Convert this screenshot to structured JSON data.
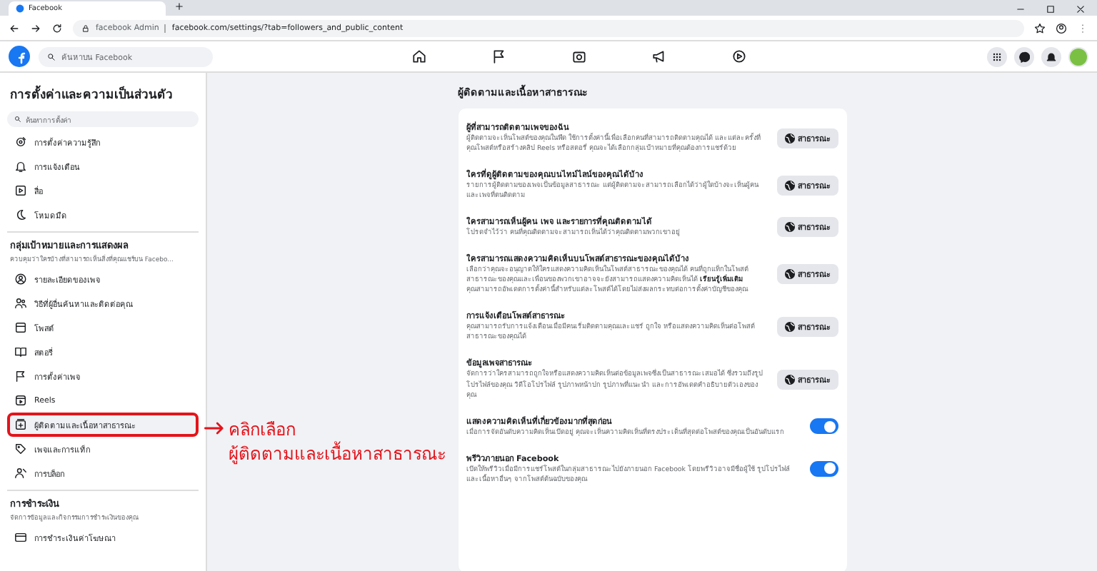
{
  "browser": {
    "tab_title": "Facebook",
    "address_label": "facebook Admin",
    "url": "facebook.com/settings/?tab=followers_and_public_content"
  },
  "header": {
    "search_placeholder": "ค้นหาบน Facebook"
  },
  "sidebar": {
    "title": "การตั้งค่าและความเป็นส่วนตัว",
    "search_placeholder": "ค้นหาการตั้งค่า",
    "sections": [
      {
        "items": [
          {
            "label": "การตั้งค่าความรู้สึก",
            "selected": false
          },
          {
            "label": "การแจ้งเตือน",
            "selected": false
          },
          {
            "label": "สื่อ",
            "selected": false
          },
          {
            "label": "โหมดมืด",
            "selected": false
          }
        ]
      },
      {
        "title": "กลุ่มเป้าหมายและการแสดงผล",
        "subtitle": "ควบคุมว่าใครบ้างที่สามารถเห็นสิ่งที่คุณแชร์บน Facebo...",
        "items": [
          {
            "label": "รายละเอียดของเพจ",
            "selected": false
          },
          {
            "label": "วิธีที่ผู้อื่นค้นหาและติดต่อคุณ",
            "selected": false
          },
          {
            "label": "โพสต์",
            "selected": false
          },
          {
            "label": "สตอรี่",
            "selected": false
          },
          {
            "label": "การตั้งค่าเพจ",
            "selected": false
          },
          {
            "label": "Reels",
            "selected": false
          },
          {
            "label": "ผู้ติดตามและเนื้อหาสาธารณะ",
            "selected": true
          },
          {
            "label": "เพจและการแท็ก",
            "selected": false
          },
          {
            "label": "การบล็อก",
            "selected": false
          }
        ]
      },
      {
        "title": "การชำระเงิน",
        "subtitle": "จัดการข้อมูลและกิจกรรมการชำระเงินของคุณ",
        "items": [
          {
            "label": "การชำระเงินค่าโฆษณา",
            "selected": false
          }
        ]
      }
    ]
  },
  "main": {
    "title": "ผู้ติดตามและเนื้อหาสาธารณะ",
    "settings": [
      {
        "kind": "audience",
        "title": "ผู้ที่สามารถติดตามเพจของฉัน",
        "description": "ผู้ติดตามจะเห็นโพสต์ของคุณในฟีด ใช้การตั้งค่านี้เพื่อเลือกคนที่สามารถติดตามคุณได้ และแต่ละครั้งที่คุณโพสต์หรือสร้างคลิป Reels หรือสตอรี่ คุณจะได้เลือกกลุ่มเป้าหมายที่คุณต้องการแชร์ด้วย",
        "button": "สาธารณะ"
      },
      {
        "kind": "audience",
        "title": "ใครที่ดูผู้ติดตามของคุณบนไทม์ไลน์ของคุณได้บ้าง",
        "description": "รายการผู้ติดตามของเพจเป็นข้อมูลสาธารณะ แต่ผู้ติดตามจะสามารถเลือกได้ว่าผู้ใดบ้างจะเห็นผู้คนและเพจที่ตนติดตาม",
        "button": "สาธารณะ"
      },
      {
        "kind": "audience",
        "title": "ใครสามารถเห็นผู้คน เพจ และรายการที่คุณติดตามได้",
        "description": "โปรดจำไว้ว่า คนที่คุณติดตามจะสามารถเห็นได้ว่าคุณติดตามพวกเขาอยู่",
        "button": "สาธารณะ"
      },
      {
        "kind": "audience",
        "title": "ใครสามารถแสดงความคิดเห็นบนโพสต์สาธารณะของคุณได้บ้าง",
        "description": "เลือกว่าคุณจะอนุญาตให้ใครแสดงความคิดเห็นในโพสต์สาธารณะของคุณได้ คนที่ถูกแท็กในโพสต์สาธารณะของคุณและเพื่อนของพวกเขาอาจจะยังสามารถแสดงความคิดเห็นได้ **เรียนรู้เพิ่มเติม**",
        "note": "คุณสามารถอัพเดตการตั้งค่านี้สำหรับแต่ละโพสต์ได้โดยไม่ส่งผลกระทบต่อการตั้งค่าบัญชีของคุณ",
        "button": "สาธารณะ"
      },
      {
        "kind": "audience",
        "title": "การแจ้งเตือนโพสต์สาธารณะ",
        "description": "คุณสามารถรับการแจ้งเตือนเมื่อมีคนเริ่มติดตามคุณและแชร์ ถูกใจ หรือแสดงความคิดเห็นต่อโพสต์สาธารณะของคุณได้",
        "button": "สาธารณะ"
      },
      {
        "kind": "audience",
        "title": "ข้อมูลเพจสาธารณะ",
        "description": "จัดการว่าใครสามารถถูกใจหรือแสดงความคิดเห็นต่อข้อมูลเพจซึ่งเป็นสาธารณะเสมอได้ ซึ่งรวมถึงรูปโปรไฟล์ของคุณ วิดีโอโปรไฟล์ รูปภาพหน้าปก รูปภาพที่แนะนำ และการอัพเดตคำอธิบายตัวเองของคุณ",
        "button": "สาธารณะ"
      },
      {
        "kind": "toggle",
        "title": "แสดงความคิดเห็นที่เกี่ยวข้องมากที่สุดก่อน",
        "description": "เมื่อการจัดอันดับความคิดเห็นเปิดอยู่ คุณจะเห็นความคิดเห็นที่ตรงประเด็นที่สุดต่อโพสต์ของคุณเป็นอันดับแรก",
        "on": true
      },
      {
        "kind": "toggle",
        "title": "พรีวิวภายนอก Facebook",
        "description": "เปิดให้พรีวิวเมื่อมีการแชร์โพสต์ในกลุ่มสาธารณะไปยังภายนอก Facebook โดยพรีวิวอาจมีชื่อผู้ใช้ รูปโปรไฟล์ และเนื้อหาอื่นๆ จากโพสต์ต้นฉบับของคุณ",
        "on": true
      }
    ]
  },
  "annotation": {
    "lines": [
      "คลิกเลือก",
      "ผู้ติดตามและเนื้อหาสาธารณะ"
    ]
  }
}
